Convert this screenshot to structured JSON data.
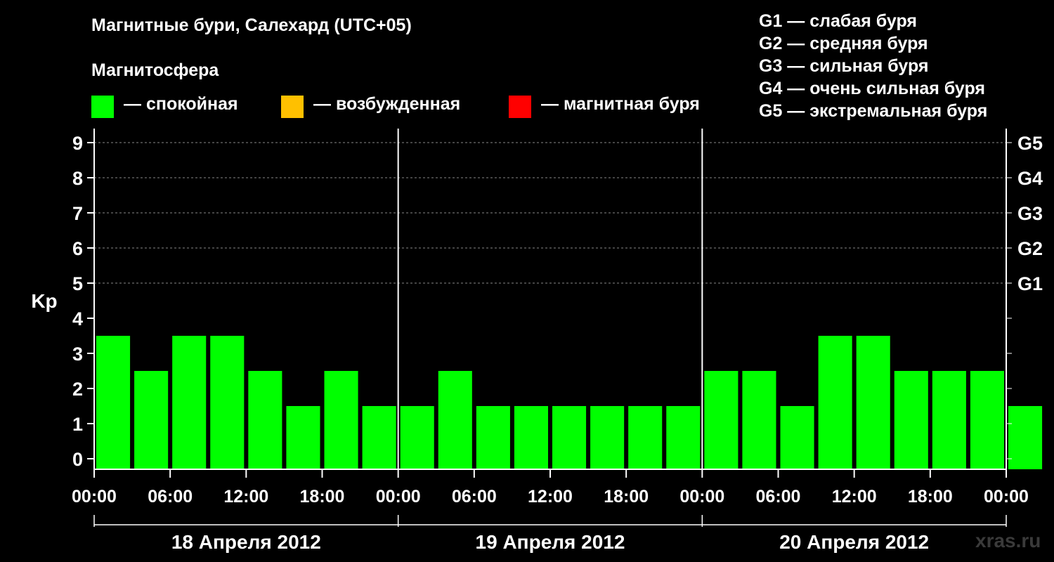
{
  "title": "Магнитные бури, Салехард (UTC+05)",
  "subtitle": "Магнитосфера",
  "legend": [
    {
      "label": "— спокойная",
      "color": "#00ff00"
    },
    {
      "label": "— возбужденная",
      "color": "#ffc000"
    },
    {
      "label": "— магнитная буря",
      "color": "#ff0000"
    }
  ],
  "g_scale": [
    "G1 — слабая буря",
    "G2 — средняя буря",
    "G3 — сильная буря",
    "G4 — очень сильная буря",
    "G5 — экстремальная буря"
  ],
  "watermark": "xras.ru",
  "chart_data": {
    "type": "bar",
    "ylabel": "Kp",
    "ylim": [
      -0.3,
      9.4
    ],
    "yticks": [
      0,
      1,
      2,
      3,
      4,
      5,
      6,
      7,
      8,
      9
    ],
    "right_ticks": [
      {
        "value": 5,
        "label": "G1"
      },
      {
        "value": 6,
        "label": "G2"
      },
      {
        "value": 7,
        "label": "G3"
      },
      {
        "value": 8,
        "label": "G4"
      },
      {
        "value": 9,
        "label": "G5"
      }
    ],
    "xrange_hours": [
      0,
      72
    ],
    "xtick_labels": [
      "00:00",
      "06:00",
      "12:00",
      "18:00",
      "00:00",
      "06:00",
      "12:00",
      "18:00",
      "00:00",
      "06:00",
      "12:00",
      "18:00",
      "00:00"
    ],
    "days": [
      "18 Апреля 2012",
      "19 Апреля 2012",
      "20 Апреля 2012"
    ],
    "bar_color": "#00ff00",
    "grid": "dashed at integer Kp from 5 to 9",
    "values": [
      3,
      2,
      3,
      3,
      2,
      1,
      2,
      1,
      1,
      2,
      1,
      1,
      1,
      1,
      1,
      1,
      2,
      2,
      1,
      3,
      3,
      2,
      2,
      2,
      1
    ]
  }
}
